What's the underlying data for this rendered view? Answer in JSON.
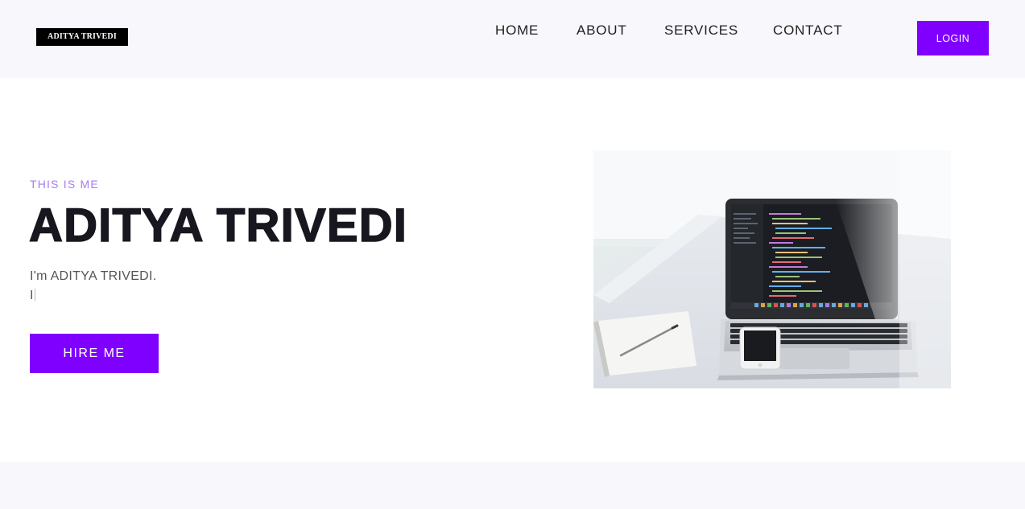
{
  "header": {
    "logo_text": "ADITYA TRIVEDI",
    "nav": {
      "home": "HOME",
      "about": "ABOUT",
      "services": "SERVICES",
      "contact": "CONTACT"
    },
    "login_label": "LOGIN"
  },
  "hero": {
    "eyebrow": "THIS IS ME",
    "title": "ADITYA TRIVEDI",
    "intro": "I'm ADITYA TRIVEDI.",
    "typed_text": "I",
    "hire_label": "HIRE ME"
  },
  "colors": {
    "accent": "#8000ff",
    "eyebrow": "#a77cf0",
    "header_bg": "#f8f8fc",
    "title": "#18171f"
  }
}
